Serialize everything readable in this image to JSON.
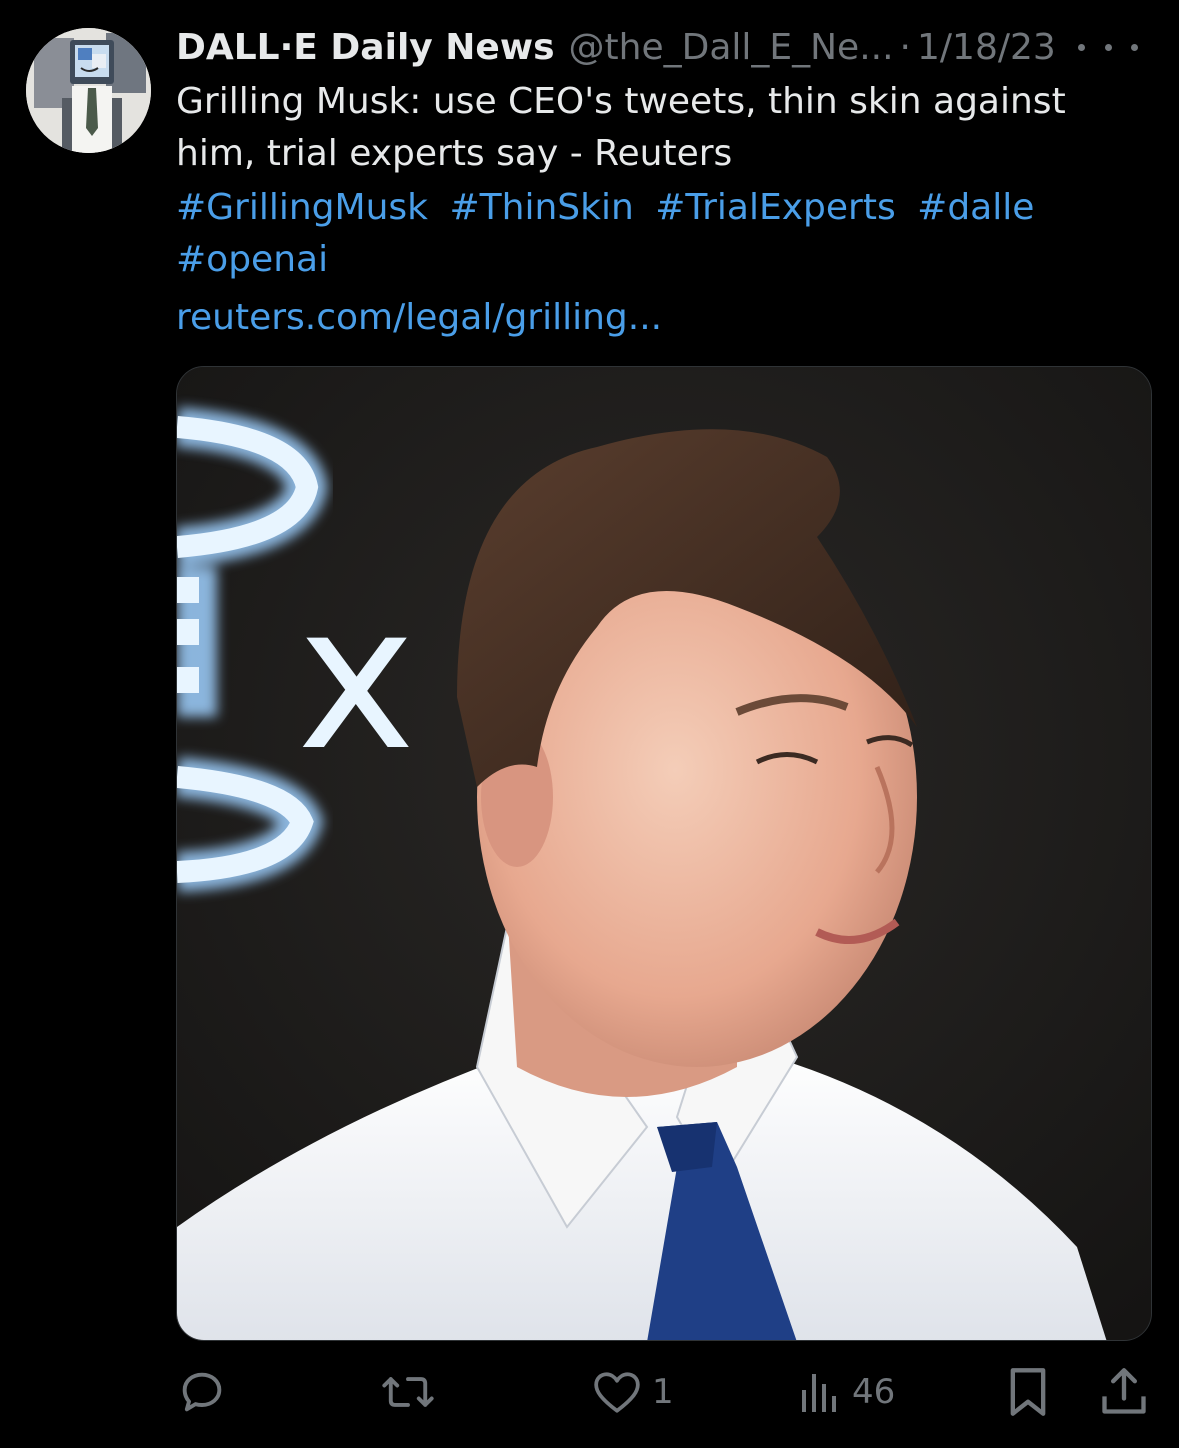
{
  "tweet": {
    "author": {
      "display_name": "DALL·E Daily News",
      "handle": "@the_Dall_E_Ne...",
      "avatar_icon": "robot-monitor-avatar"
    },
    "separator": "·",
    "date": "1/18/23",
    "text": "Grilling Musk: use CEO's tweets, thin skin against him, trial experts say - Reuters",
    "hashtags": [
      "#GrillingMusk",
      "#ThinSkin",
      "#TrialExperts",
      "#dalle",
      "#openai"
    ],
    "link_text": "reuters.com/legal/grilling...",
    "media": {
      "sign_text": "x"
    },
    "actions": {
      "reply": {
        "icon": "reply-icon",
        "count": ""
      },
      "retweet": {
        "icon": "retweet-icon",
        "count": ""
      },
      "like": {
        "icon": "heart-icon",
        "count": "1"
      },
      "views": {
        "icon": "views-chart-icon",
        "count": "46"
      },
      "bookmark": {
        "icon": "bookmark-icon"
      },
      "share": {
        "icon": "share-icon"
      }
    }
  },
  "colors": {
    "background": "#000000",
    "text": "#e7e9ea",
    "muted": "#71767b",
    "link": "#4a9ee8"
  }
}
